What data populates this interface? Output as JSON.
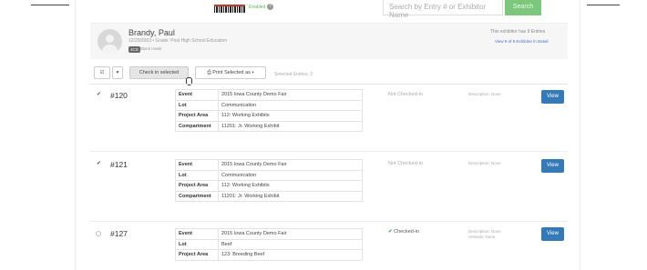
{
  "topbar": {
    "enabled_label": "Enabled",
    "help_icon": "question-icon",
    "search_placeholder": "Search by Entry # or Exhibitor Name",
    "search_button": "Search"
  },
  "exhibitor": {
    "name": "Brandy, Paul",
    "info": "12/29/2003 • Grade: Post High School Education",
    "badge": "4CS",
    "club": "Black Hawk",
    "entries_text": "This exhibitor has 9 Entries",
    "view_all": "View 9 of 9 Exhibitor in Detail"
  },
  "toolbar": {
    "checkin_label": "Check in selected",
    "print_label": "Print Selected as",
    "selected_count": "Selected Entries: 2"
  },
  "entries": [
    {
      "number": "#120",
      "checked": true,
      "rows": [
        {
          "k": "Event",
          "v": "2015 Iowa County Demo Fair"
        },
        {
          "k": "Lot",
          "v": "Communication"
        },
        {
          "k": "Project Area",
          "v": "112: Working Exhibits"
        },
        {
          "k": "Compartment",
          "v": "11201: Jr. Working Exhibit"
        }
      ],
      "status": "Not Checked-in",
      "desc": "Description: None",
      "desc2": "",
      "view": "View"
    },
    {
      "number": "#121",
      "checked": true,
      "rows": [
        {
          "k": "Event",
          "v": "2015 Iowa County Demo Fair"
        },
        {
          "k": "Lot",
          "v": "Communication"
        },
        {
          "k": "Project Area",
          "v": "112: Working Exhibits"
        },
        {
          "k": "Compartment",
          "v": "11201: Jr. Working Exhibit"
        }
      ],
      "status": "Not Checked-in",
      "desc": "Description: None",
      "desc2": "",
      "view": "View"
    },
    {
      "number": "#127",
      "checked": false,
      "rows": [
        {
          "k": "Event",
          "v": "2015 Iowa County Demo Fair"
        },
        {
          "k": "Lot",
          "v": "Beef"
        },
        {
          "k": "Project Area",
          "v": "123: Breeding Beef"
        }
      ],
      "status": "Checked-in",
      "desc": "Description: None",
      "desc2": "Animals: None",
      "view": "View"
    }
  ]
}
